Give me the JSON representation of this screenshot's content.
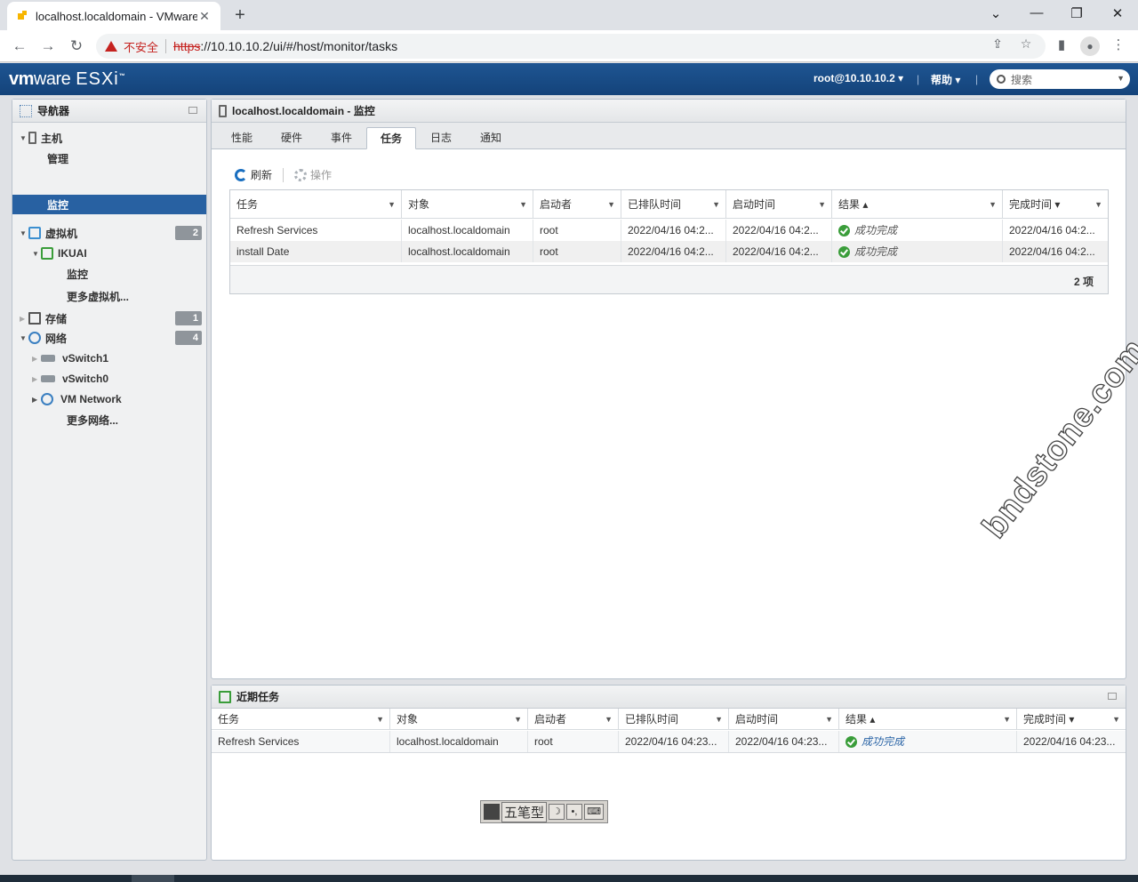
{
  "browser": {
    "tab_title": "localhost.localdomain - VMware",
    "close": "✕",
    "new_tab": "+",
    "security_warning": "不安全",
    "url_scheme": "https",
    "url_rest": "://10.10.10.2/ui/#/host/monitor/tasks"
  },
  "header": {
    "logo_vm": "vm",
    "logo_ware": "ware",
    "logo_product": "ESXi",
    "user": "root@10.10.10.2 ▾",
    "help": "帮助 ▾",
    "search_placeholder": "搜索"
  },
  "navigator": {
    "title": "导航器",
    "items": [
      {
        "label": "主机"
      },
      {
        "label": "管理"
      },
      {
        "label": "监控"
      },
      {
        "label": "虚拟机",
        "badge": "2"
      },
      {
        "label": "IKUAI"
      },
      {
        "label": "监控"
      },
      {
        "label": "更多虚拟机..."
      },
      {
        "label": "存储",
        "badge": "1"
      },
      {
        "label": "网络",
        "badge": "4"
      },
      {
        "label": "vSwitch1"
      },
      {
        "label": "vSwitch0"
      },
      {
        "label": "VM Network"
      },
      {
        "label": "更多网络..."
      }
    ]
  },
  "main": {
    "title": "localhost.localdomain - 监控",
    "tabs": [
      "性能",
      "硬件",
      "事件",
      "任务",
      "日志",
      "通知"
    ],
    "active_tab": "任务",
    "refresh": "刷新",
    "actions": "操作",
    "columns": [
      "任务",
      "对象",
      "启动者",
      "已排队时间",
      "启动时间",
      "结果 ▴",
      "完成时间 ▾"
    ],
    "rows": [
      {
        "task": "Refresh Services",
        "object": "localhost.localdomain",
        "initiator": "root",
        "queued": "2022/04/16 04:2...",
        "started": "2022/04/16 04:2...",
        "result": "成功完成",
        "completed": "2022/04/16 04:2..."
      },
      {
        "task": "install Date",
        "object": "localhost.localdomain",
        "initiator": "root",
        "queued": "2022/04/16 04:2...",
        "started": "2022/04/16 04:2...",
        "result": "成功完成",
        "completed": "2022/04/16 04:2..."
      }
    ],
    "count": "2 项"
  },
  "recent": {
    "title": "近期任务",
    "columns": [
      "任务",
      "对象",
      "启动者",
      "已排队时间",
      "启动时间",
      "结果 ▴",
      "完成时间 ▾"
    ],
    "rows": [
      {
        "task": "Refresh Services",
        "object": "localhost.localdomain",
        "initiator": "root",
        "queued": "2022/04/16 04:23...",
        "started": "2022/04/16 04:23...",
        "result": "成功完成",
        "completed": "2022/04/16 04:23..."
      }
    ]
  },
  "watermark": "bndstone.com",
  "ime": {
    "label": "五笔型",
    "moon": "☽",
    "punct": "•,",
    "keyboard": "⌨"
  }
}
